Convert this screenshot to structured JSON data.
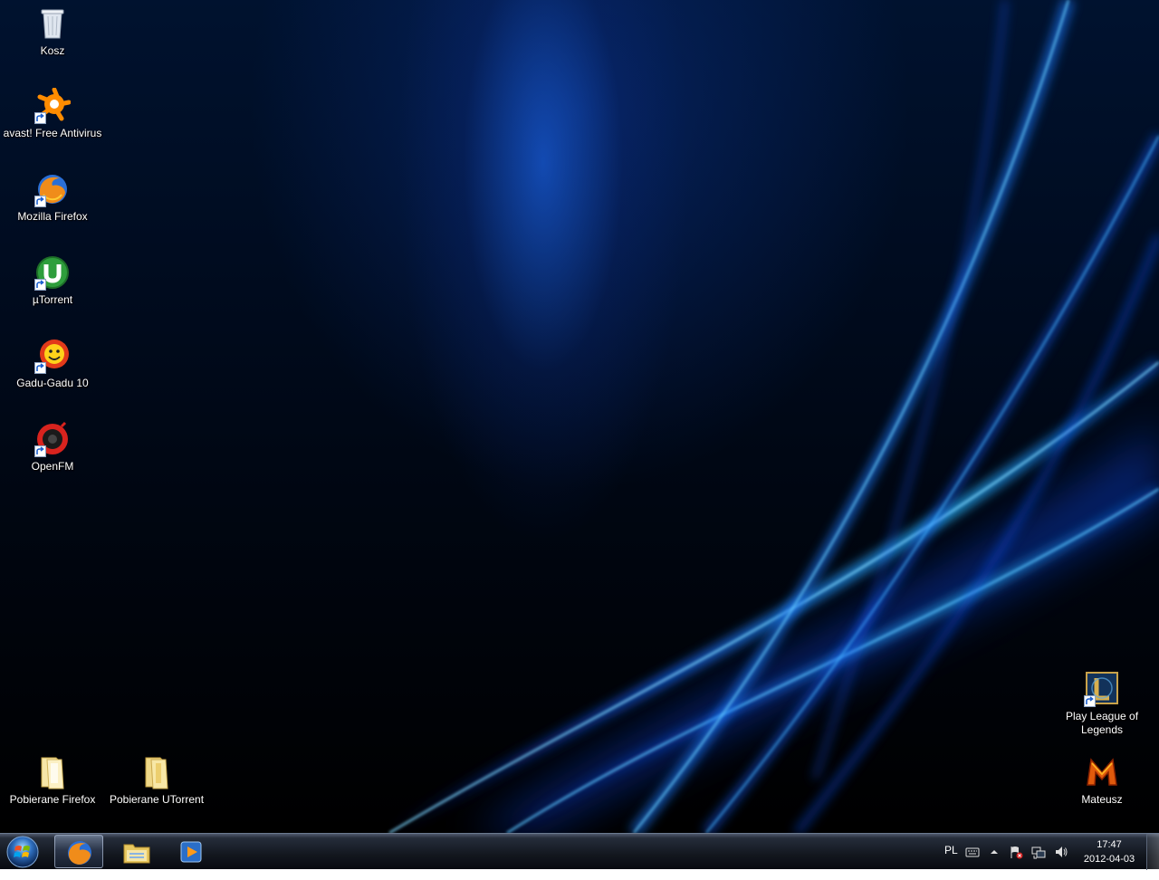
{
  "desktop": {
    "icons": [
      {
        "label": "Kosz",
        "icon": "recycle-bin-icon"
      },
      {
        "label": "avast! Free Antivirus",
        "icon": "avast-icon"
      },
      {
        "label": "Mozilla Firefox",
        "icon": "firefox-icon"
      },
      {
        "label": "µTorrent",
        "icon": "utorrent-icon"
      },
      {
        "label": "Gadu-Gadu 10",
        "icon": "gadu-gadu-icon"
      },
      {
        "label": "OpenFM",
        "icon": "openfm-icon"
      },
      {
        "label": "Pobierane Firefox",
        "icon": "folder-icon"
      },
      {
        "label": "Pobierane UTorrent",
        "icon": "folder-icon"
      },
      {
        "label": "Play League of Legends",
        "icon": "league-of-legends-icon"
      },
      {
        "label": "Mateusz",
        "icon": "mateusz-m-icon"
      }
    ]
  },
  "taskbar": {
    "pinned": [
      {
        "name": "Mozilla Firefox",
        "icon": "firefox-icon",
        "active": true
      },
      {
        "name": "Windows Explorer",
        "icon": "explorer-folder-icon",
        "active": false
      },
      {
        "name": "Windows Media Player",
        "icon": "media-player-icon",
        "active": false
      }
    ],
    "tray": {
      "language": "PL",
      "time": "17:47",
      "date": "2012-04-03"
    }
  },
  "colors": {
    "wallpaper_accent": "#1e8bff",
    "taskbar": "#10141c"
  }
}
